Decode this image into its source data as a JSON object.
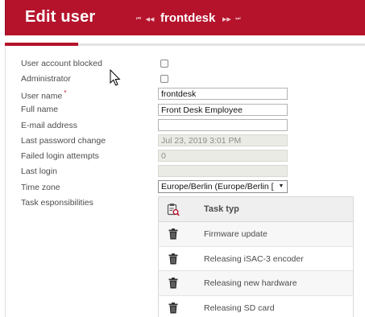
{
  "header": {
    "title": "Edit user",
    "current_user": "frontdesk",
    "nav_first_glyph": "⏮",
    "nav_prev_glyph": "◀◀",
    "nav_next_glyph": "▶▶",
    "nav_last_glyph": "⏭"
  },
  "form": {
    "blocked_label": "User account blocked",
    "admin_label": "Administrator",
    "username_label": "User name",
    "username_required_mark": "*",
    "username_value": "frontdesk",
    "fullname_label": "Full name",
    "fullname_value": "Front Desk Employee",
    "email_label": "E-mail address",
    "email_value": "",
    "lastpw_label": "Last password change",
    "lastpw_value": "Jul 23, 2019 3:01 PM",
    "failed_label": "Failed login attempts",
    "failed_value": "0",
    "lastlogin_label": "Last login",
    "lastlogin_value": "",
    "timezone_label": "Time zone",
    "timezone_value": "Europe/Berlin (Europe/Berlin [",
    "tasks_label": "Task esponsibilities"
  },
  "tasks": {
    "header": "Task typ",
    "items": [
      {
        "name": "Firmware update"
      },
      {
        "name": "Releasing iSAC-3 encoder"
      },
      {
        "name": "Releasing new hardware"
      },
      {
        "name": "Releasing SD card"
      }
    ]
  },
  "colors": {
    "brand": "#b5132c",
    "header_text": "#ffffff",
    "label_text": "#4d4d4d"
  },
  "icons": {
    "task_header": "task-list-search-icon",
    "row_action": "trash-icon"
  }
}
